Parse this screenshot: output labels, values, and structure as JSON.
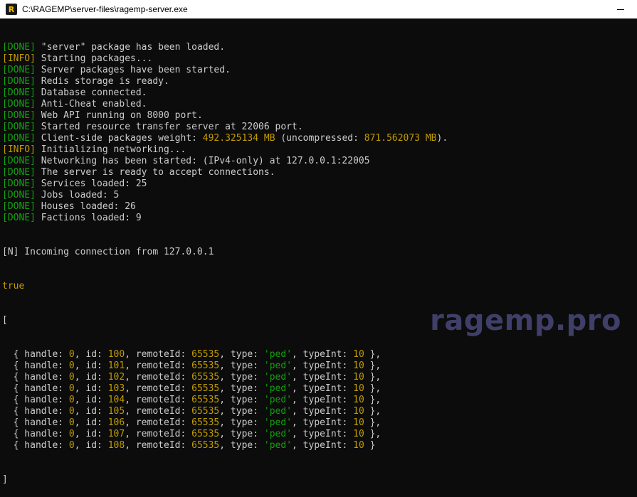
{
  "window": {
    "title": "C:\\RAGEMP\\server-files\\ragemp-server.exe",
    "icon": "ragemp-app-icon",
    "icon_letter": "R",
    "minimize_icon": "minimize-icon"
  },
  "console": {
    "log": [
      {
        "tag": "[DONE]",
        "kind": "done",
        "msg": "\"server\" package has been loaded."
      },
      {
        "tag": "[INFO]",
        "kind": "info",
        "msg": "Starting packages..."
      },
      {
        "tag": "[DONE]",
        "kind": "done",
        "msg": "Server packages have been started."
      },
      {
        "tag": "[DONE]",
        "kind": "done",
        "msg": "Redis storage is ready."
      },
      {
        "tag": "[DONE]",
        "kind": "done",
        "msg": "Database connected."
      },
      {
        "tag": "[DONE]",
        "kind": "done",
        "msg": "Anti-Cheat enabled."
      },
      {
        "tag": "[DONE]",
        "kind": "done",
        "msg": "Web API running on 8000 port."
      },
      {
        "tag": "[DONE]",
        "kind": "done",
        "msg": "Started resource transfer server at 22006 port."
      },
      {
        "tag": "[DONE]",
        "kind": "done",
        "msg": "Client-side packages weight: ",
        "hl1": "492.325134 MB",
        "mid": " (uncompressed: ",
        "hl2": "871.562073 MB",
        "end": ")."
      },
      {
        "tag": "[INFO]",
        "kind": "info",
        "msg": "Initializing networking..."
      },
      {
        "tag": "[DONE]",
        "kind": "done",
        "msg": "Networking has been started: (IPv4-only) at 127.0.0.1:22005"
      },
      {
        "tag": "[DONE]",
        "kind": "done",
        "msg": "The server is ready to accept connections."
      },
      {
        "tag": "[DONE]",
        "kind": "done",
        "msg": "Services loaded: 25"
      },
      {
        "tag": "[DONE]",
        "kind": "done",
        "msg": "Jobs loaded: 5"
      },
      {
        "tag": "[DONE]",
        "kind": "done",
        "msg": "Houses loaded: 26"
      },
      {
        "tag": "[DONE]",
        "kind": "done",
        "msg": "Factions loaded: 9"
      }
    ],
    "incoming": "[N] Incoming connection from 127.0.0.1",
    "bool_value": "true",
    "array_open": "[",
    "array_close": "]",
    "entities": [
      {
        "handle": "0",
        "id": "100",
        "remoteId": "65535",
        "type": "'ped'",
        "typeInt": "10",
        "sep": " },"
      },
      {
        "handle": "0",
        "id": "101",
        "remoteId": "65535",
        "type": "'ped'",
        "typeInt": "10",
        "sep": " },"
      },
      {
        "handle": "0",
        "id": "102",
        "remoteId": "65535",
        "type": "'ped'",
        "typeInt": "10",
        "sep": " },"
      },
      {
        "handle": "0",
        "id": "103",
        "remoteId": "65535",
        "type": "'ped'",
        "typeInt": "10",
        "sep": " },"
      },
      {
        "handle": "0",
        "id": "104",
        "remoteId": "65535",
        "type": "'ped'",
        "typeInt": "10",
        "sep": " },"
      },
      {
        "handle": "0",
        "id": "105",
        "remoteId": "65535",
        "type": "'ped'",
        "typeInt": "10",
        "sep": " },"
      },
      {
        "handle": "0",
        "id": "106",
        "remoteId": "65535",
        "type": "'ped'",
        "typeInt": "10",
        "sep": " },"
      },
      {
        "handle": "0",
        "id": "107",
        "remoteId": "65535",
        "type": "'ped'",
        "typeInt": "10",
        "sep": " },"
      },
      {
        "handle": "0",
        "id": "108",
        "remoteId": "65535",
        "type": "'ped'",
        "typeInt": "10",
        "sep": " }"
      }
    ],
    "keys": {
      "open": "  { handle: ",
      "id": ", id: ",
      "remoteId": ", remoteId: ",
      "type": ", type: ",
      "typeInt": ", typeInt: "
    }
  },
  "watermark": "ragemp.pro",
  "colors": {
    "background": "#0c0c0c",
    "text": "#cccccc",
    "done": "#13a10e",
    "info": "#c19c00",
    "watermark": "#3f3f69"
  }
}
